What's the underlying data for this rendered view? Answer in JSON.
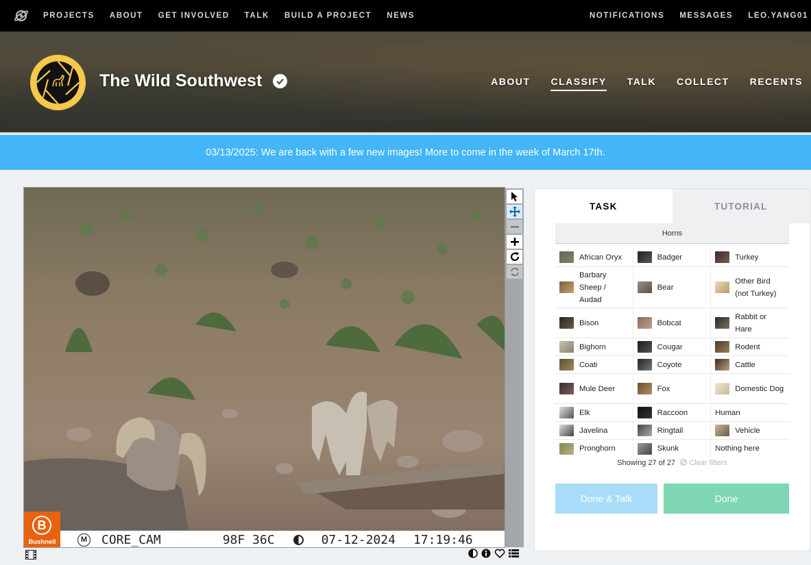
{
  "topnav": {
    "items": [
      "PROJECTS",
      "ABOUT",
      "GET INVOLVED",
      "TALK",
      "BUILD A PROJECT",
      "NEWS"
    ],
    "right": [
      "NOTIFICATIONS",
      "MESSAGES",
      "LEO.YANG01"
    ]
  },
  "project": {
    "title": "The Wild Southwest",
    "nav": [
      "ABOUT",
      "CLASSIFY",
      "TALK",
      "COLLECT",
      "RECENTS"
    ],
    "active_nav": "CLASSIFY"
  },
  "announcement": "03/13/2025: We are back with a few new images! More to come in the week of March 17th.",
  "camera": {
    "brand": "Bushnell",
    "brand_letter": "B",
    "moon_letter": "M",
    "name": "CORE_CAM",
    "temp": "98F 36C",
    "date": "07-12-2024",
    "time": "17:19:46"
  },
  "tabs": [
    "TASK",
    "TUTORIAL"
  ],
  "filter_header": "Horns",
  "choices": [
    [
      "African Oryx",
      "Badger",
      "Turkey"
    ],
    [
      "Barbary Sheep / Audad",
      "Bear",
      "Other Bird (not Turkey)"
    ],
    [
      "Bison",
      "Bobcat",
      "Rabbit or Hare"
    ],
    [
      "Bighorn",
      "Cougar",
      "Rodent"
    ],
    [
      "Coati",
      "Coyote",
      "Cattle"
    ],
    [
      "Mule Deer",
      "Fox",
      "Domestic Dog"
    ],
    [
      "Elk",
      "Raccoon",
      "Human"
    ],
    [
      "Javelina",
      "Ringtail",
      "Vehicle"
    ],
    [
      "Pronghorn",
      "Skunk",
      "Nothing here"
    ]
  ],
  "showing": "Showing 27 of 27",
  "clear_filters": "Clear filters",
  "buttons": {
    "done_talk": "Done & Talk",
    "done": "Done"
  },
  "colors": {
    "announcement": "#43b5f8",
    "done": "#7fd6b3",
    "done_talk": "#a8dcf8",
    "brand_badge": "#e8630f",
    "avatar": "#f6c84b"
  }
}
